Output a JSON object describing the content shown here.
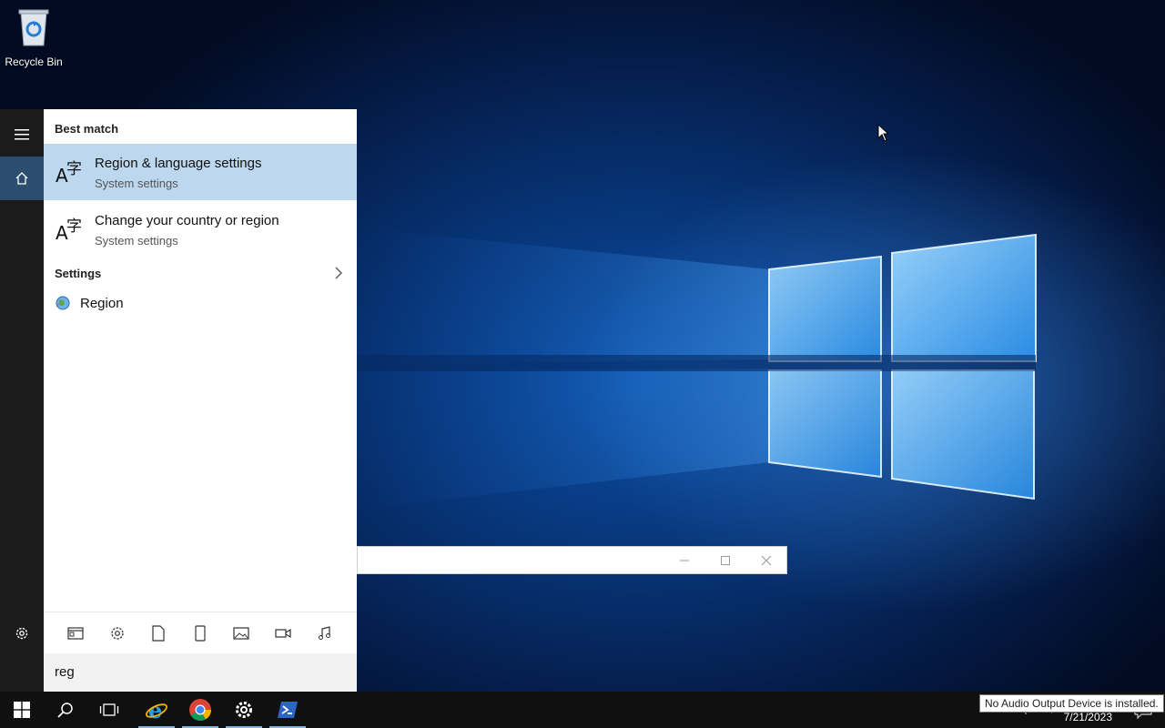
{
  "desktop": {
    "icons": [
      {
        "label": "Recycle Bin",
        "icon": "recycle-bin-icon"
      }
    ]
  },
  "start_search": {
    "rail": [
      "hamburger-menu-icon",
      "home-icon",
      "gear-icon"
    ],
    "best_match_heading": "Best match",
    "results": [
      {
        "title": "Region & language settings",
        "subtitle": "System settings",
        "icon": "language-icon",
        "selected": true
      },
      {
        "title": "Change your country or region",
        "subtitle": "System settings",
        "icon": "language-icon",
        "selected": false
      }
    ],
    "settings_heading": "Settings",
    "settings_items": [
      {
        "title": "Region",
        "icon": "globe-icon"
      }
    ],
    "filters": [
      "apps-filter-icon",
      "settings-filter-icon",
      "documents-filter-icon",
      "tablet-filter-icon",
      "photos-filter-icon",
      "videos-filter-icon",
      "music-filter-icon"
    ],
    "query": "reg"
  },
  "taskbar": {
    "pinned": [
      "start-icon",
      "search-icon",
      "task-view-icon",
      "internet-explorer-icon",
      "chrome-icon",
      "settings-icon",
      "powershell-icon"
    ],
    "date": "7/21/2023",
    "tooltip": "No Audio Output Device is installed."
  },
  "colors": {
    "accent": "#bcd7ee",
    "taskbar": "#101010",
    "rail": "#1b1b1b"
  }
}
